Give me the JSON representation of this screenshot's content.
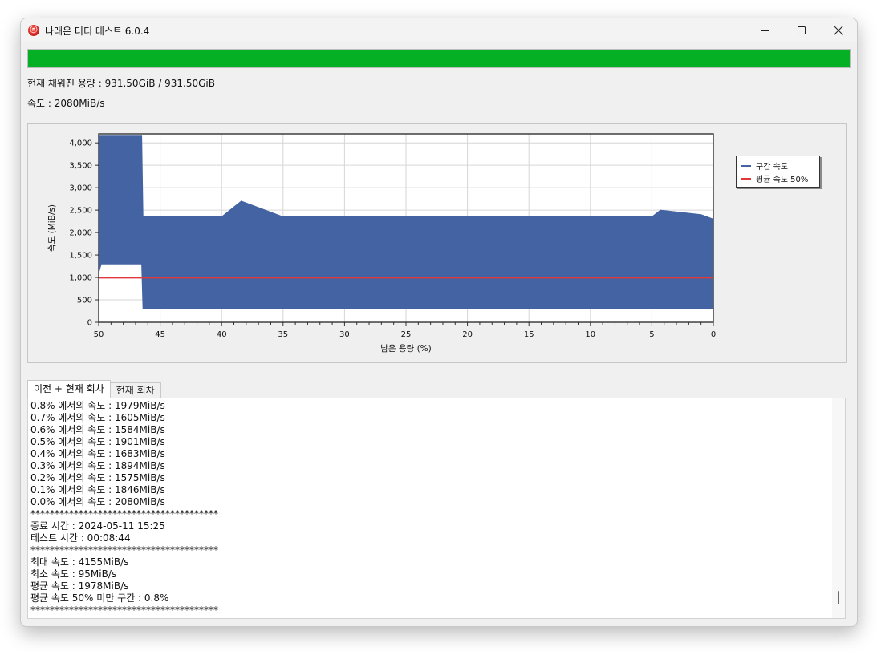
{
  "window": {
    "title": "나래온 더티 테스트 6.0.4",
    "app_icon": "naraeon-logo-icon",
    "controls": [
      "minimize-icon",
      "maximize-icon",
      "close-icon"
    ]
  },
  "progress": {
    "fraction": 1.0,
    "color": "#06b025"
  },
  "info": {
    "capacity_label": "현재 채워진 용량 : 931.50GiB / 931.50GiB",
    "speed_label": "속도 : 2080MiB/s"
  },
  "chart_data": {
    "type": "area",
    "xlabel": "남은 용량 (%)",
    "ylabel": "속도 (MiB/s)",
    "xlim": [
      50,
      0
    ],
    "ylim": [
      0,
      4200
    ],
    "x_ticks": [
      "50",
      "45",
      "40",
      "35",
      "30",
      "25",
      "20",
      "15",
      "10",
      "5",
      "0"
    ],
    "y_ticks": [
      "0",
      "500",
      "1,000",
      "1,500",
      "2,000",
      "2,500",
      "3,000",
      "3,500",
      "4,000"
    ],
    "y_tick_values": [
      0,
      500,
      1000,
      1500,
      2000,
      2500,
      3000,
      3500,
      4000
    ],
    "grid": true,
    "legend_position": "right",
    "series": [
      {
        "name": "구간 속도",
        "color": "#4363a2",
        "x": [
          50,
          49.8,
          49.5,
          49.5,
          47,
          46.5,
          46.4,
          45,
          40,
          38.4,
          35,
          30,
          25,
          20,
          15,
          10,
          5,
          4.3,
          1,
          0
        ],
        "upper": [
          4150,
          4150,
          4150,
          4150,
          4150,
          4150,
          2350,
          2350,
          2350,
          2700,
          2350,
          2350,
          2350,
          2350,
          2350,
          2350,
          2350,
          2500,
          2400,
          2300
        ],
        "lower": [
          1100,
          1300,
          1300,
          1300,
          1300,
          1300,
          300,
          300,
          300,
          300,
          300,
          300,
          300,
          300,
          300,
          300,
          300,
          300,
          300,
          300
        ]
      },
      {
        "name": "평균 속도 50%",
        "color": "#e0393c",
        "x": [
          50,
          0
        ],
        "values": [
          989,
          989
        ]
      }
    ]
  },
  "tabs": [
    {
      "label": "이전 + 현재 회차",
      "active": true
    },
    {
      "label": "현재 회차",
      "active": false
    }
  ],
  "log": [
    "0.8% 에서의 속도 : 1979MiB/s",
    "0.7% 에서의 속도 : 1605MiB/s",
    "0.6% 에서의 속도 : 1584MiB/s",
    "0.5% 에서의 속도 : 1901MiB/s",
    "0.4% 에서의 속도 : 1683MiB/s",
    "0.3% 에서의 속도 : 1894MiB/s",
    "0.2% 에서의 속도 : 1575MiB/s",
    "0.1% 에서의 속도 : 1846MiB/s",
    "0.0% 에서의 속도 : 2080MiB/s",
    "***************************************",
    "종료 시간 : 2024-05-11 15:25",
    "테스트 시간 : 00:08:44",
    "***************************************",
    "최대 속도 : 4155MiB/s",
    "최소 속도 : 95MiB/s",
    "평균 속도 : 1978MiB/s",
    "평균 속도 50% 미만 구간 : 0.8%",
    "***************************************"
  ]
}
